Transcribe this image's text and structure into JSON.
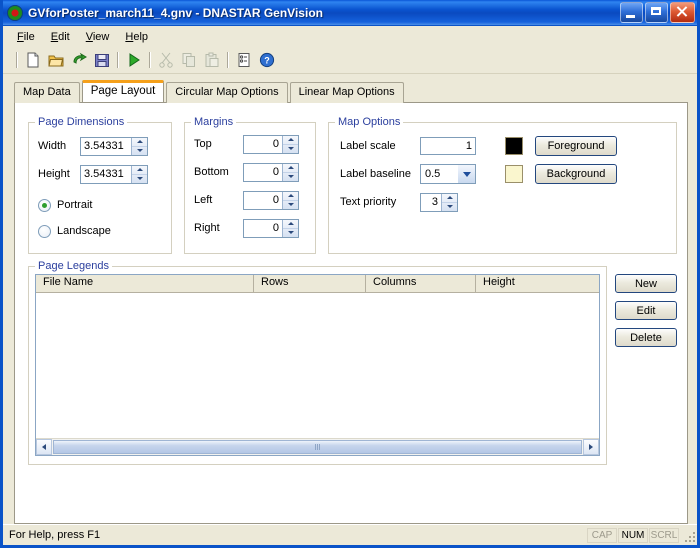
{
  "window": {
    "title": "GVforPoster_march11_4.gnv - DNASTAR GenVision",
    "app_icon": "genvision-icon",
    "controls": {
      "minimize": "minimize-button",
      "maximize": "maximize-button",
      "close": "close-button"
    },
    "accent_titlebar": "#0a54d0"
  },
  "menu": [
    {
      "label": "File",
      "accel": "F"
    },
    {
      "label": "Edit",
      "accel": "E"
    },
    {
      "label": "View",
      "accel": "V"
    },
    {
      "label": "Help",
      "accel": "H"
    }
  ],
  "toolbar": [
    {
      "name": "new-icon",
      "enabled": true
    },
    {
      "name": "open-icon",
      "enabled": true
    },
    {
      "name": "export-icon",
      "enabled": true
    },
    {
      "name": "save-icon",
      "enabled": true
    },
    {
      "name": "run-icon",
      "enabled": true
    },
    {
      "name": "cut-icon",
      "enabled": false
    },
    {
      "name": "copy-icon",
      "enabled": false
    },
    {
      "name": "paste-icon",
      "enabled": false
    },
    {
      "name": "properties-icon",
      "enabled": true
    },
    {
      "name": "help-icon",
      "enabled": true
    }
  ],
  "tabs": [
    {
      "label": "Map Data",
      "active": false
    },
    {
      "label": "Page Layout",
      "active": true
    },
    {
      "label": "Circular Map Options",
      "active": false
    },
    {
      "label": "Linear Map Options",
      "active": false
    }
  ],
  "page_dimensions": {
    "legend": "Page Dimensions",
    "width_label": "Width",
    "width_value": "3.54331",
    "height_label": "Height",
    "height_value": "3.54331",
    "orientation": [
      {
        "label": "Portrait",
        "selected": true
      },
      {
        "label": "Landscape",
        "selected": false
      }
    ]
  },
  "margins": {
    "legend": "Margins",
    "fields": [
      {
        "label": "Top",
        "value": "0"
      },
      {
        "label": "Bottom",
        "value": "0"
      },
      {
        "label": "Left",
        "value": "0"
      },
      {
        "label": "Right",
        "value": "0"
      }
    ]
  },
  "map_options": {
    "legend": "Map Options",
    "label_scale_label": "Label scale",
    "label_scale_value": "1",
    "label_baseline_label": "Label baseline",
    "label_baseline_value": "0.5",
    "text_priority_label": "Text priority",
    "text_priority_value": "3",
    "foreground_label": "Foreground",
    "foreground_color": "#000000",
    "background_label": "Background",
    "background_color": "#FAF6CE"
  },
  "page_legends": {
    "legend": "Page Legends",
    "columns": [
      "File Name",
      "Rows",
      "Columns",
      "Height"
    ],
    "rows": [],
    "buttons": [
      "New",
      "Edit",
      "Delete"
    ]
  },
  "status": {
    "message": "For Help, press F1",
    "indicators": [
      {
        "label": "CAP",
        "active": false
      },
      {
        "label": "NUM",
        "active": true
      },
      {
        "label": "SCRL",
        "active": false
      }
    ]
  }
}
